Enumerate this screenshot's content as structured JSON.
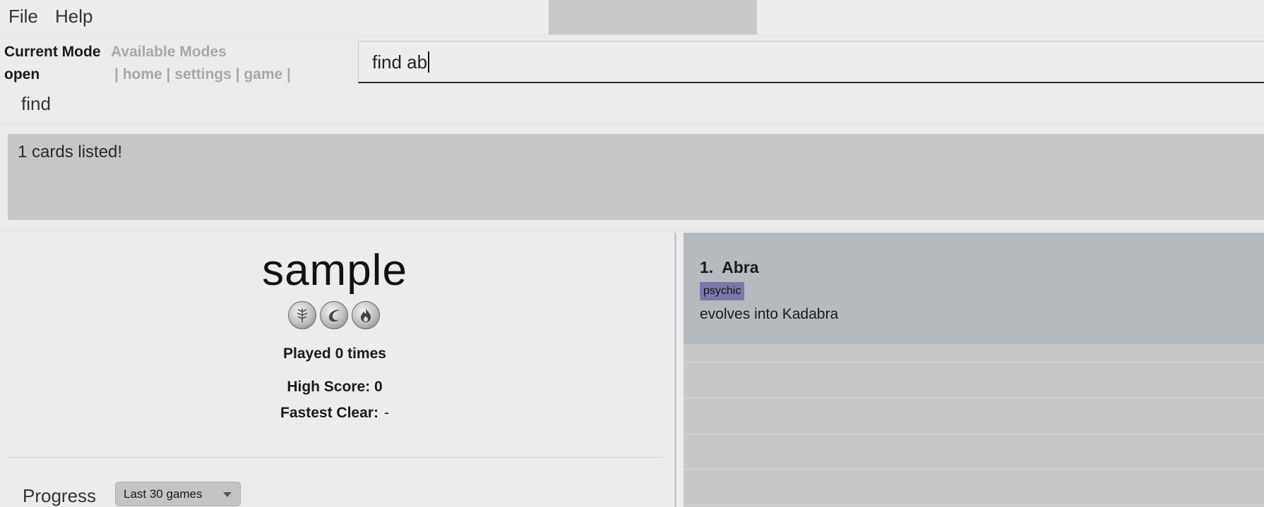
{
  "menu": {
    "file": "File",
    "help": "Help"
  },
  "mode": {
    "current_title": "Current Mode",
    "current_value": "open",
    "available_title": "Available Modes",
    "available_list": "| home | settings | game |"
  },
  "command": {
    "value": "find ab"
  },
  "suggestion": "find",
  "result": {
    "message": "1 cards listed!"
  },
  "deck": {
    "name": "sample",
    "badge_icons": [
      "leaf-icon",
      "water-icon",
      "fire-icon"
    ],
    "played": "Played 0 times",
    "high_score": "High Score: 0",
    "fastest_label": "Fastest Clear:",
    "fastest_value": "-"
  },
  "progress": {
    "label": "Progress",
    "range": "Last 30 games"
  },
  "cards": [
    {
      "title": "1.  Abra",
      "tag": "psychic",
      "description": "evolves into Kadabra"
    }
  ],
  "colors": {
    "tag": "#7a7aa8",
    "selected_card": "#b4babd",
    "result_bg": "#c6c6c6"
  }
}
